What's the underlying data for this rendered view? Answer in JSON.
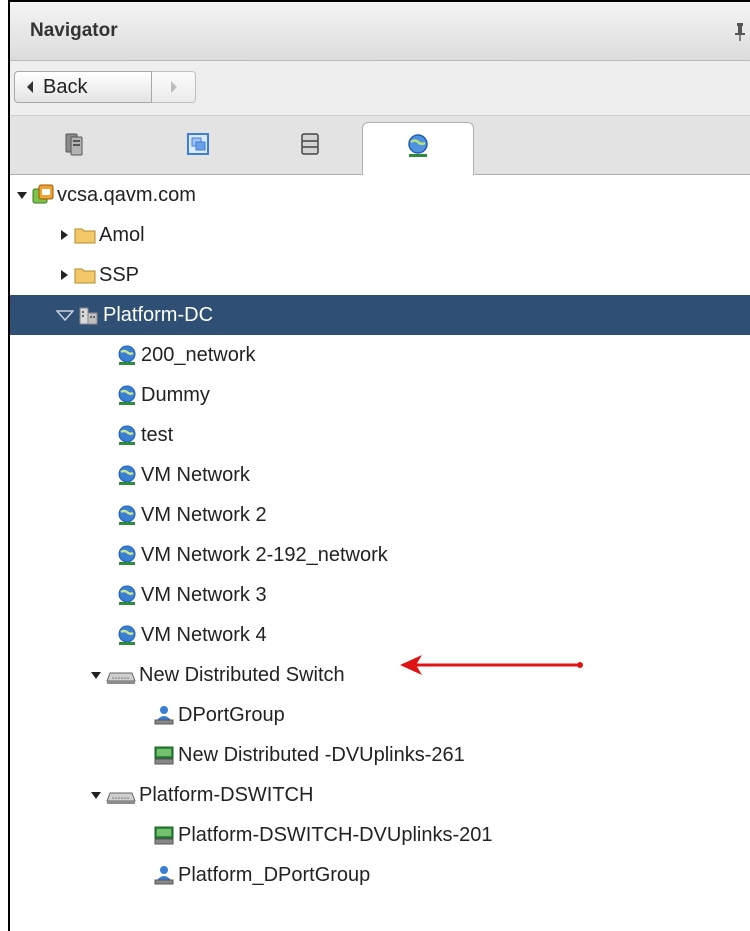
{
  "panel": {
    "title": "Navigator"
  },
  "nav": {
    "back_label": "Back"
  },
  "tabs": [
    {
      "name": "hosts-and-clusters",
      "icon": "hosts-clusters-icon"
    },
    {
      "name": "vms-and-templates",
      "icon": "vms-templates-icon"
    },
    {
      "name": "storage",
      "icon": "storage-icon"
    },
    {
      "name": "networking",
      "icon": "network-icon",
      "active": true
    }
  ],
  "tree": {
    "root": {
      "label": "vcsa.qavm.com",
      "icon": "vcenter-icon",
      "expanded": true
    },
    "folders": [
      {
        "label": "Amol",
        "icon": "folder-icon",
        "expanded": false
      },
      {
        "label": "SSP",
        "icon": "folder-icon",
        "expanded": false
      }
    ],
    "datacenter": {
      "label": "Platform-DC",
      "icon": "datacenter-icon",
      "expanded": true,
      "selected": true
    },
    "networks": [
      {
        "label": "200_network"
      },
      {
        "label": "Dummy"
      },
      {
        "label": "test"
      },
      {
        "label": "VM Network"
      },
      {
        "label": "VM Network 2"
      },
      {
        "label": "VM Network 2-192_network"
      },
      {
        "label": "VM Network 3"
      },
      {
        "label": "VM Network 4"
      }
    ],
    "switches": [
      {
        "label": "New Distributed Switch",
        "expanded": true,
        "annotated": true,
        "children": [
          {
            "label": "DPortGroup",
            "icon": "portgroup-icon"
          },
          {
            "label": "New Distributed -DVUplinks-261",
            "icon": "uplinks-icon"
          }
        ]
      },
      {
        "label": "Platform-DSWITCH",
        "expanded": true,
        "children": [
          {
            "label": "Platform-DSWITCH-DVUplinks-201",
            "icon": "uplinks-icon"
          },
          {
            "label": "Platform_DPortGroup",
            "icon": "portgroup-icon"
          }
        ]
      }
    ]
  },
  "colors": {
    "selected_bg": "#2f4f74",
    "annotation_arrow": "#e01414",
    "folder": "#f3c868",
    "network_globe": "#3a7fd5"
  }
}
